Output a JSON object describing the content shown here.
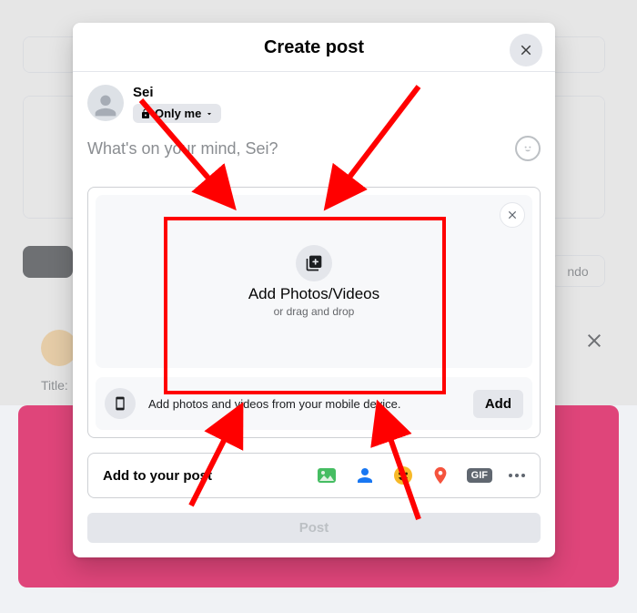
{
  "modal": {
    "title": "Create post"
  },
  "user": {
    "name": "Sei",
    "privacy_label": "Only me"
  },
  "composer": {
    "placeholder": "What's on your mind, Sei?"
  },
  "media": {
    "drop_title": "Add Photos/Videos",
    "drop_sub": "or drag and drop",
    "mobile_text": "Add photos and videos from your mobile device.",
    "add_label": "Add"
  },
  "options": {
    "label": "Add to your post",
    "gif": "GIF"
  },
  "post_button": "Post",
  "background": {
    "title_label": "Title:",
    "button_label": "ndo"
  }
}
